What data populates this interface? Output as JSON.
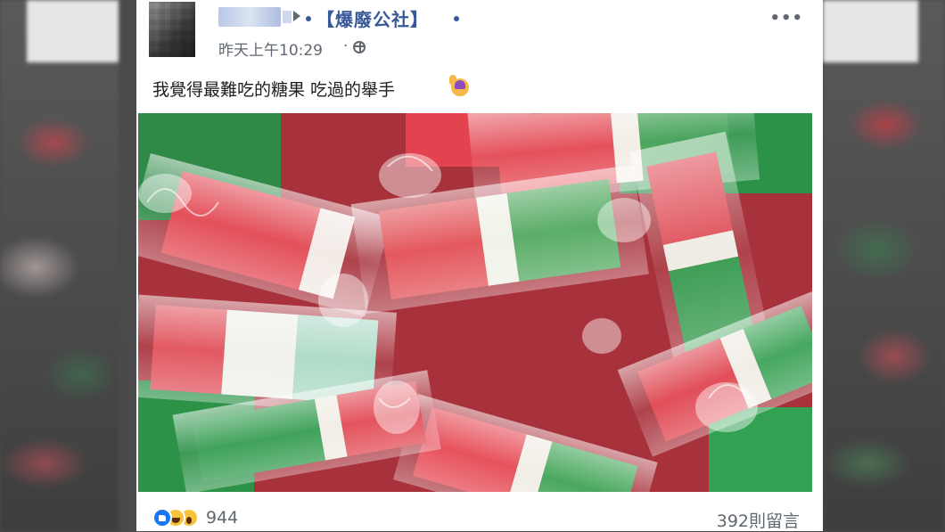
{
  "post": {
    "group_name": "【爆廢公社】",
    "timestamp": "昨天上午10:29",
    "separator": "·",
    "text": "我覺得最難吃的糖果 吃過的舉手",
    "reaction_count": "944",
    "comment_count": "392則留言"
  },
  "icons": {
    "more": "more-options-icon",
    "audience": "globe-icon",
    "reactions": [
      "like-icon",
      "haha-icon",
      "wow-icon"
    ],
    "emoji": "raise-hand-icon"
  },
  "colors": {
    "link": "#385898",
    "secondary_text": "#606770",
    "body_text": "#1c1e21",
    "like_blue": "#1877f2",
    "candy_red": "#d9444f",
    "candy_green": "#2f9a4c",
    "candy_white": "#e8f0e8"
  }
}
